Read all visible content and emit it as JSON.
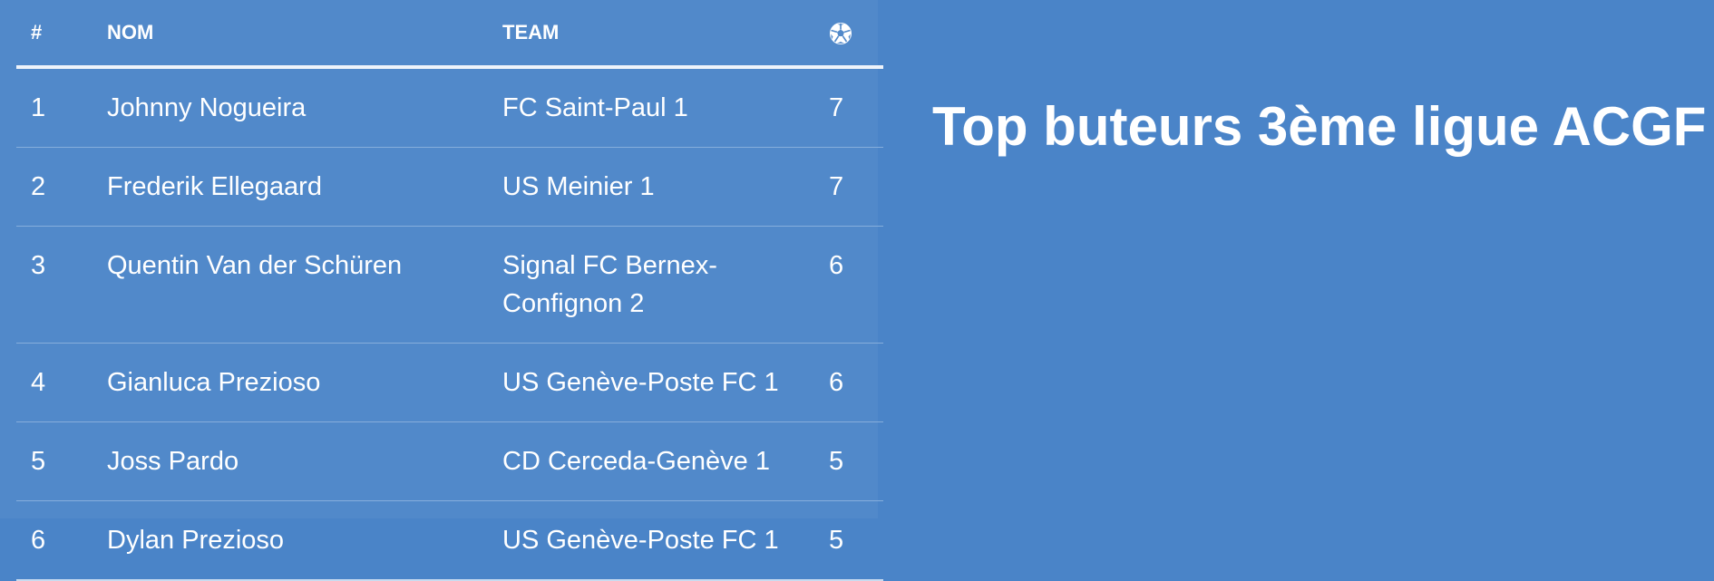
{
  "page": {
    "title": "Top buteurs 3ème ligue ACGF"
  },
  "table": {
    "headers": {
      "rank": "#",
      "name": "NOM",
      "team": "TEAM",
      "goals_icon": "soccer-ball-icon"
    },
    "rows": [
      {
        "rank": "1",
        "name": "Johnny Nogueira",
        "team": "FC Saint-Paul 1",
        "goals": "7"
      },
      {
        "rank": "2",
        "name": "Frederik Ellegaard",
        "team": "US Meinier 1",
        "goals": "7"
      },
      {
        "rank": "3",
        "name": "Quentin Van der Schüren",
        "team": "Signal FC Bernex-Confignon 2",
        "goals": "6"
      },
      {
        "rank": "4",
        "name": "Gianluca Prezioso",
        "team": "US Genève-Poste FC 1",
        "goals": "6"
      },
      {
        "rank": "5",
        "name": "Joss Pardo",
        "team": "CD Cerceda-Genève 1",
        "goals": "5"
      },
      {
        "rank": "6",
        "name": "Dylan Prezioso",
        "team": "US Genève-Poste FC 1",
        "goals": "5"
      }
    ]
  },
  "colors": {
    "background": "#4a84c8",
    "panel": "#5189ca",
    "text": "#ffffff"
  }
}
